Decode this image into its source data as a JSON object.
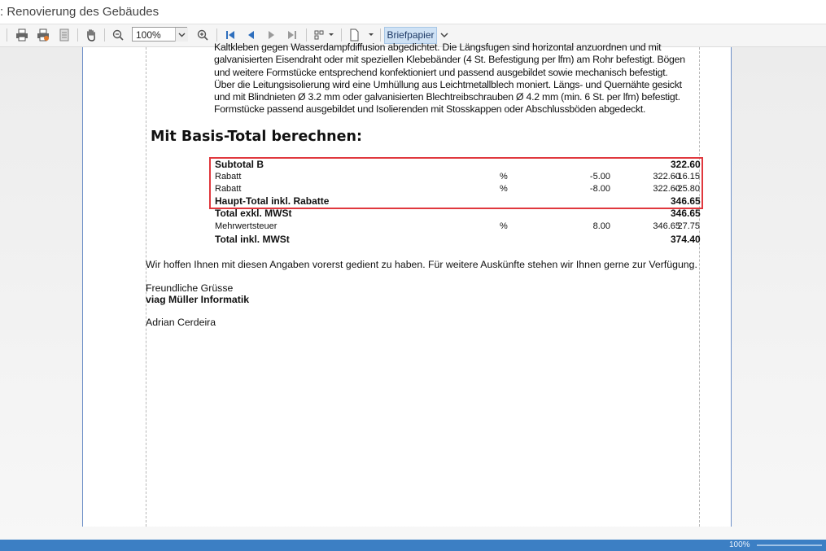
{
  "window": {
    "title": ": Renovierung des Gebäudes"
  },
  "toolbar": {
    "zoom_value": "100%",
    "stationery_button_label": "Briefpapier",
    "icons": [
      "print-icon",
      "print-preview-icon",
      "page-setup-icon",
      "hand-tool-icon",
      "zoom-out-icon",
      "zoom-in-icon",
      "first-page-icon",
      "previous-page-icon",
      "next-page-icon",
      "last-page-icon",
      "multi-page-icon",
      "export-icon",
      "chevron-down-icon"
    ]
  },
  "document": {
    "body_lines": [
      "Kaltkleben gegen Wasserdampfdiffusion abgedichtet. Die Längsfugen sind horizontal anzuordnen und mit",
      "galvanisierten Eisendraht oder mit speziellen Klebebänder (4 St. Befestigung per lfm) am Rohr befestigt. Bögen",
      "und weitere Formstücke entsprechend konfektioniert und passend ausgebildet sowie mechanisch befestigt.",
      "Über die Leitungsisolierung wird eine Umhüllung aus Leichtmetallblech moniert. Längs- und Quernähte gesickt",
      "und mit Blindnieten Ø 3.2 mm oder galvanisierten Blechtreibschrauben Ø 4.2 mm (min. 6 St. per lfm) befestigt.",
      "Formstücke passend ausgebildet und Isolierenden mit Stosskappen oder Abschlussböden abgedeckt."
    ],
    "section_heading": "Mit Basis-Total berechnen:",
    "totals_rows": [
      {
        "label": "Subtotal B",
        "unit": "",
        "percent": "",
        "base": "",
        "amount": "322.60"
      },
      {
        "label": "Rabatt",
        "unit": "%",
        "percent": "-5.00",
        "base": "322.60",
        "amount": "-16.15"
      },
      {
        "label": "Rabatt",
        "unit": "%",
        "percent": "-8.00",
        "base": "322.60",
        "amount": "-25.80"
      },
      {
        "label": "Haupt-Total inkl. Rabatte",
        "unit": "",
        "percent": "",
        "base": "",
        "amount": "346.65"
      },
      {
        "label": "Total exkl. MWSt",
        "unit": "",
        "percent": "",
        "base": "",
        "amount": "346.65"
      },
      {
        "label": "Mehrwertsteuer",
        "unit": "%",
        "percent": "8.00",
        "base": "346.65",
        "amount": "27.75"
      },
      {
        "label": "Total inkl. MWSt",
        "unit": "",
        "percent": "",
        "base": "",
        "amount": "374.40"
      }
    ],
    "closing_text": "Wir hoffen Ihnen mit diesen Angaben vorerst gedient zu haben. Für weitere Auskünfte stehen wir Ihnen gerne zur Verfügung.",
    "greeting": "Freundliche Grüsse",
    "company": "viag Müller Informatik",
    "signatory": "Adrian Cerdeira"
  },
  "status_bar": {
    "zoom": "100%"
  },
  "colors": {
    "highlight": "#e0383e",
    "statusbar": "#3c7fc4",
    "stationery_button": "#cfe2f5"
  }
}
